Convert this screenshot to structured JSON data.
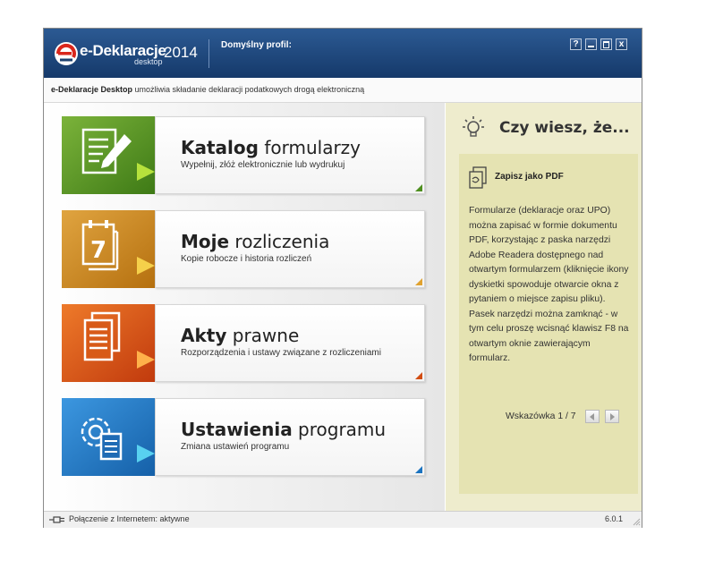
{
  "titlebar": {
    "brand_name": "e-Deklaracje",
    "brand_sub": "desktop",
    "year": "2014",
    "profile_label": "Domyślny profil:",
    "help_button": "?",
    "close_button": "x"
  },
  "infobar": {
    "app_name": "e-Deklaracje Desktop",
    "text": " umożliwia składanie deklaracji podatkowych drogą elektroniczną"
  },
  "tiles": [
    {
      "title_bold": "Katalog",
      "title_rest": " formularzy",
      "desc": "Wypełnij, złóż elektronicznie lub wydrukuj",
      "icon": "form-pencil-icon",
      "color": "#4e8f1f"
    },
    {
      "title_bold": "Moje",
      "title_rest": " rozliczenia",
      "desc": "Kopie robocze i historia rozliczeń",
      "icon": "calendar-7-icon",
      "color": "#c98718",
      "day": "7"
    },
    {
      "title_bold": "Akty",
      "title_rest": " prawne",
      "desc": "Rozporządzenia i ustawy związane z rozliczeniami",
      "icon": "documents-icon",
      "color": "#d24d12"
    },
    {
      "title_bold": "Ustawienia",
      "title_rest": " programu",
      "desc": "Zmiana ustawień programu",
      "icon": "gear-document-icon",
      "color": "#1a73c0"
    }
  ],
  "tips": {
    "header": "Czy wiesz, że...",
    "title": "Zapisz jako PDF",
    "body": "Formularze (deklaracje oraz UPO) można zapisać w formie dokumentu PDF, korzystając z paska narzędzi Adobe Readera dostępnego nad otwartym formularzem (kliknięcie ikony dyskietki spowoduje otwarcie okna z pytaniem o miejsce zapisu pliku). Pasek narzędzi można zamknąć - w tym celu proszę wcisnąć klawisz F8 na otwartym oknie zawierającym formularz.",
    "pager": "Wskazówka 1 / 7"
  },
  "statusbar": {
    "connection": "Połączenie z Internetem: aktywne",
    "version": "6.0.1"
  }
}
